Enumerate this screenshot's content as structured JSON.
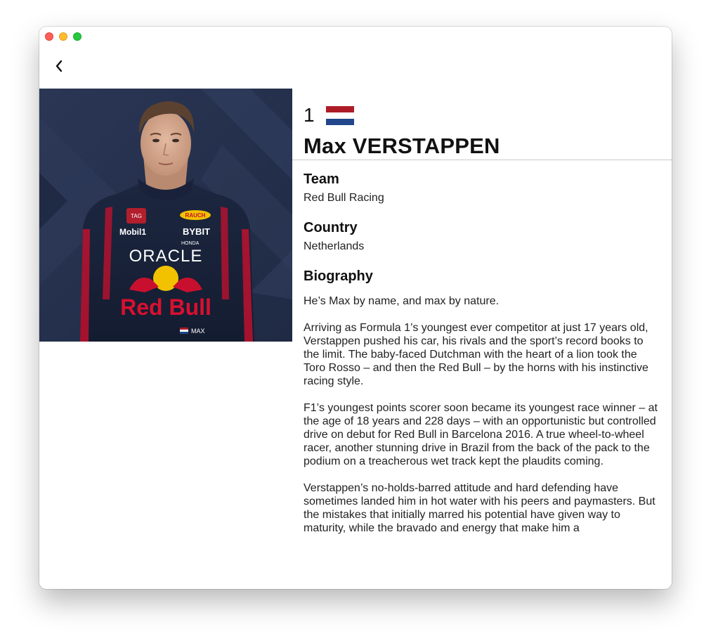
{
  "window": {
    "traffic_lights": [
      "close",
      "minimize",
      "zoom"
    ]
  },
  "nav": {
    "back_icon": "chevron-left-icon"
  },
  "driver": {
    "number": "1",
    "flag_colors": [
      "#ae1c28",
      "#ffffff",
      "#21468b"
    ],
    "name": "Max VERSTAPPEN",
    "photo_label": "Driver portrait photo"
  },
  "sections": {
    "team_title": "Team",
    "team_value": "Red Bull Racing",
    "country_title": "Country",
    "country_value": "Netherlands",
    "bio_title": "Biography"
  },
  "biography": [
    "He’s Max by name, and max by nature.",
    "Arriving as Formula 1’s youngest ever competitor at just 17 years old, Verstappen pushed his car, his rivals and the sport’s record books to the limit. The baby-faced Dutchman with the heart of a lion took the Toro Rosso – and then the Red Bull – by the horns with his instinctive racing style.",
    "F1’s youngest points scorer soon became its youngest race winner – at the age of 18 years and 228 days – with an opportunistic but controlled drive on debut for Red Bull in Barcelona 2016. A true wheel-to-wheel racer, another stunning drive in Brazil from the back of the pack to the podium on a treacherous wet track kept the plaudits coming.",
    "Verstappen’s no-holds-barred attitude and hard defending have sometimes landed him in hot water with his peers and paymasters. But the mistakes that initially marred his potential have given way to maturity, while the bravado and energy that make him a"
  ],
  "suit_text": {
    "oracle": "ORACLE",
    "redbull": "Red Bull",
    "bybit": "BYBIT",
    "honda": "HONDA",
    "mobil": "Mobil1",
    "tag": "TAG",
    "rauch": "RAUCH",
    "max": "MAX"
  }
}
